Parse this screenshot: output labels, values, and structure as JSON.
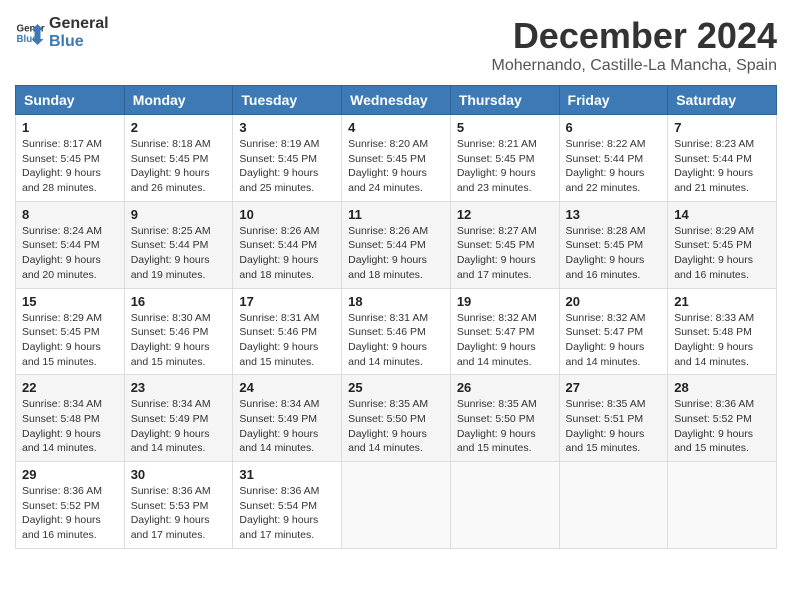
{
  "logo": {
    "line1": "General",
    "line2": "Blue"
  },
  "title": "December 2024",
  "subtitle": "Mohernando, Castille-La Mancha, Spain",
  "days_of_week": [
    "Sunday",
    "Monday",
    "Tuesday",
    "Wednesday",
    "Thursday",
    "Friday",
    "Saturday"
  ],
  "weeks": [
    [
      {
        "day": "1",
        "sunrise": "8:17 AM",
        "sunset": "5:45 PM",
        "daylight": "9 hours and 28 minutes."
      },
      {
        "day": "2",
        "sunrise": "8:18 AM",
        "sunset": "5:45 PM",
        "daylight": "9 hours and 26 minutes."
      },
      {
        "day": "3",
        "sunrise": "8:19 AM",
        "sunset": "5:45 PM",
        "daylight": "9 hours and 25 minutes."
      },
      {
        "day": "4",
        "sunrise": "8:20 AM",
        "sunset": "5:45 PM",
        "daylight": "9 hours and 24 minutes."
      },
      {
        "day": "5",
        "sunrise": "8:21 AM",
        "sunset": "5:45 PM",
        "daylight": "9 hours and 23 minutes."
      },
      {
        "day": "6",
        "sunrise": "8:22 AM",
        "sunset": "5:44 PM",
        "daylight": "9 hours and 22 minutes."
      },
      {
        "day": "7",
        "sunrise": "8:23 AM",
        "sunset": "5:44 PM",
        "daylight": "9 hours and 21 minutes."
      }
    ],
    [
      {
        "day": "8",
        "sunrise": "8:24 AM",
        "sunset": "5:44 PM",
        "daylight": "9 hours and 20 minutes."
      },
      {
        "day": "9",
        "sunrise": "8:25 AM",
        "sunset": "5:44 PM",
        "daylight": "9 hours and 19 minutes."
      },
      {
        "day": "10",
        "sunrise": "8:26 AM",
        "sunset": "5:44 PM",
        "daylight": "9 hours and 18 minutes."
      },
      {
        "day": "11",
        "sunrise": "8:26 AM",
        "sunset": "5:44 PM",
        "daylight": "9 hours and 18 minutes."
      },
      {
        "day": "12",
        "sunrise": "8:27 AM",
        "sunset": "5:45 PM",
        "daylight": "9 hours and 17 minutes."
      },
      {
        "day": "13",
        "sunrise": "8:28 AM",
        "sunset": "5:45 PM",
        "daylight": "9 hours and 16 minutes."
      },
      {
        "day": "14",
        "sunrise": "8:29 AM",
        "sunset": "5:45 PM",
        "daylight": "9 hours and 16 minutes."
      }
    ],
    [
      {
        "day": "15",
        "sunrise": "8:29 AM",
        "sunset": "5:45 PM",
        "daylight": "9 hours and 15 minutes."
      },
      {
        "day": "16",
        "sunrise": "8:30 AM",
        "sunset": "5:46 PM",
        "daylight": "9 hours and 15 minutes."
      },
      {
        "day": "17",
        "sunrise": "8:31 AM",
        "sunset": "5:46 PM",
        "daylight": "9 hours and 15 minutes."
      },
      {
        "day": "18",
        "sunrise": "8:31 AM",
        "sunset": "5:46 PM",
        "daylight": "9 hours and 14 minutes."
      },
      {
        "day": "19",
        "sunrise": "8:32 AM",
        "sunset": "5:47 PM",
        "daylight": "9 hours and 14 minutes."
      },
      {
        "day": "20",
        "sunrise": "8:32 AM",
        "sunset": "5:47 PM",
        "daylight": "9 hours and 14 minutes."
      },
      {
        "day": "21",
        "sunrise": "8:33 AM",
        "sunset": "5:48 PM",
        "daylight": "9 hours and 14 minutes."
      }
    ],
    [
      {
        "day": "22",
        "sunrise": "8:34 AM",
        "sunset": "5:48 PM",
        "daylight": "9 hours and 14 minutes."
      },
      {
        "day": "23",
        "sunrise": "8:34 AM",
        "sunset": "5:49 PM",
        "daylight": "9 hours and 14 minutes."
      },
      {
        "day": "24",
        "sunrise": "8:34 AM",
        "sunset": "5:49 PM",
        "daylight": "9 hours and 14 minutes."
      },
      {
        "day": "25",
        "sunrise": "8:35 AM",
        "sunset": "5:50 PM",
        "daylight": "9 hours and 14 minutes."
      },
      {
        "day": "26",
        "sunrise": "8:35 AM",
        "sunset": "5:50 PM",
        "daylight": "9 hours and 15 minutes."
      },
      {
        "day": "27",
        "sunrise": "8:35 AM",
        "sunset": "5:51 PM",
        "daylight": "9 hours and 15 minutes."
      },
      {
        "day": "28",
        "sunrise": "8:36 AM",
        "sunset": "5:52 PM",
        "daylight": "9 hours and 15 minutes."
      }
    ],
    [
      {
        "day": "29",
        "sunrise": "8:36 AM",
        "sunset": "5:52 PM",
        "daylight": "9 hours and 16 minutes."
      },
      {
        "day": "30",
        "sunrise": "8:36 AM",
        "sunset": "5:53 PM",
        "daylight": "9 hours and 17 minutes."
      },
      {
        "day": "31",
        "sunrise": "8:36 AM",
        "sunset": "5:54 PM",
        "daylight": "9 hours and 17 minutes."
      },
      null,
      null,
      null,
      null
    ]
  ],
  "labels": {
    "sunrise": "Sunrise:",
    "sunset": "Sunset:",
    "daylight": "Daylight:"
  }
}
